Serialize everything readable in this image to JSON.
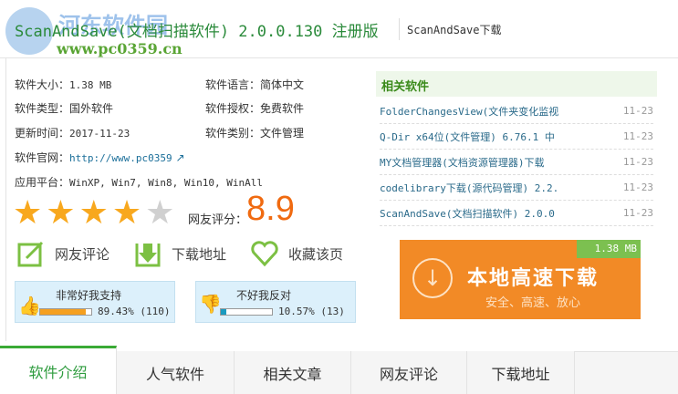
{
  "header": {
    "title": "ScanAndSave(文档扫描软件) 2.0.0.130 注册版",
    "subtitle": "ScanAndSave下载",
    "watermark": "河东软件园",
    "watermark_url": "www.pc0359.cn"
  },
  "info": {
    "size_label": "软件大小：",
    "size": "1.38 MB",
    "lang_label": "软件语言：",
    "lang": "简体中文",
    "type_label": "软件类型：",
    "type": "国外软件",
    "license_label": "软件授权：",
    "license": "免费软件",
    "date_label": "更新时间：",
    "date": "2017-11-23",
    "category_label": "软件类别：",
    "category": "文件管理",
    "site_label": "软件官网：",
    "site": "http://www.pc0359",
    "platform_label": "应用平台：",
    "platform": "WinXP, Win7, Win8, Win10, WinAll"
  },
  "rating": {
    "stars_filled": 4,
    "stars_total": 5,
    "label": "网友评分：",
    "score": "8.9"
  },
  "actions": {
    "comment": "网友评论",
    "download": "下载地址",
    "favorite": "收藏该页"
  },
  "votes": {
    "up": {
      "label": "非常好我支持",
      "percent": 89.43,
      "text": "89.43% (110)"
    },
    "down": {
      "label": "不好我反对",
      "percent": 10.57,
      "text": "10.57% (13)"
    }
  },
  "related": {
    "title": "相关软件",
    "items": [
      {
        "name": "FolderChangesView(文件夹变化监视",
        "date": "11-23"
      },
      {
        "name": "Q-Dir x64位(文件管理) 6.76.1 中",
        "date": "11-23"
      },
      {
        "name": "MY文档管理器(文档资源管理器)下载",
        "date": "11-23"
      },
      {
        "name": "codelibrary下载(源代码管理) 2.2.",
        "date": "11-23"
      },
      {
        "name": "ScanAndSave(文档扫描软件) 2.0.0",
        "date": "11-23"
      }
    ]
  },
  "download_btn": {
    "size": "1.38 MB",
    "title": "本地高速下载",
    "subtitle": "安全、高速、放心"
  },
  "tabs": [
    "软件介绍",
    "人气软件",
    "相关文章",
    "网友评论",
    "下载地址"
  ],
  "colors": {
    "accent": "#3aaa35",
    "orange": "#f28a26",
    "score": "#f06a10"
  }
}
